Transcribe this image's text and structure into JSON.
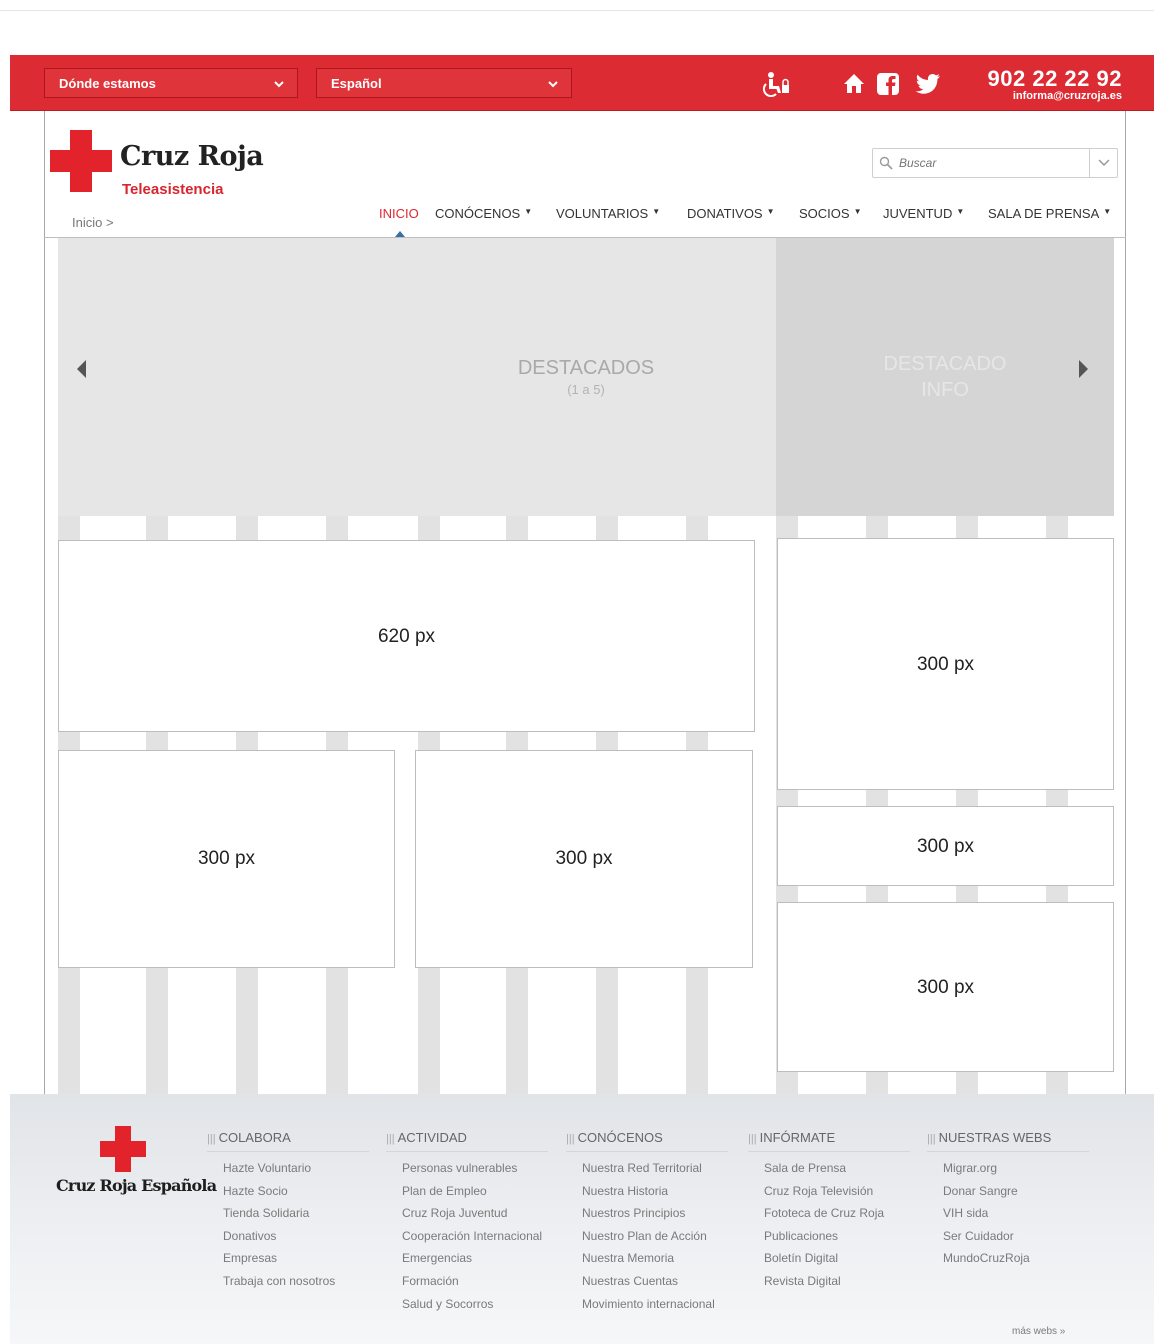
{
  "topbar": {
    "location_select": "Dónde estamos",
    "language_select": "Español",
    "phone": "902 22 22 92",
    "email": "informa@cruzroja.es",
    "icons": [
      "accessibility-icon",
      "home-icon",
      "facebook-icon",
      "twitter-icon"
    ],
    "bar_color": "#dd2b33"
  },
  "header": {
    "brand_title": "Cruz Roja",
    "brand_subtitle": "Teleasistencia",
    "breadcrumb": "Inicio >",
    "search_placeholder": "Buscar",
    "accent_color": "#e1272f"
  },
  "nav": [
    {
      "label": "INICIO",
      "active": true,
      "dropdown": false
    },
    {
      "label": "CONÓCENOS",
      "active": false,
      "dropdown": true
    },
    {
      "label": "VOLUNTARIOS",
      "active": false,
      "dropdown": true
    },
    {
      "label": "DONATIVOS",
      "active": false,
      "dropdown": true
    },
    {
      "label": "SOCIOS",
      "active": false,
      "dropdown": true
    },
    {
      "label": "JUVENTUD",
      "active": false,
      "dropdown": true
    },
    {
      "label": "SALA DE PRENSA",
      "active": false,
      "dropdown": true
    }
  ],
  "carousel": {
    "title": "DESTACADOS",
    "subtitle": "(1 a 5)",
    "info_title": "DESTACADO",
    "info_subtitle": "INFO"
  },
  "boxes": {
    "wide": "620 px",
    "right_top": "300 px",
    "left_bottom": "300 px",
    "middle_bottom": "300 px",
    "right_middle": "300 px",
    "right_bottom": "300 px"
  },
  "footer": {
    "brand": "Cruz Roja Española",
    "more_link": "más webs »",
    "columns": [
      {
        "heading": "COLABORA",
        "items": [
          "Hazte Voluntario",
          "Hazte Socio",
          "Tienda Solidaria",
          "Donativos",
          "Empresas",
          "Trabaja con nosotros"
        ]
      },
      {
        "heading": "ACTIVIDAD",
        "items": [
          "Personas vulnerables",
          "Plan de Empleo",
          "Cruz Roja Juventud",
          "Cooperación Internacional",
          "Emergencias",
          "Formación",
          "Salud y Socorros"
        ]
      },
      {
        "heading": "CONÓCENOS",
        "items": [
          "Nuestra Red Territorial",
          "Nuestra Historia",
          "Nuestros Principios",
          "Nuestro Plan de Acción",
          "Nuestra Memoria",
          "Nuestras Cuentas",
          "Movimiento internacional"
        ]
      },
      {
        "heading": "INFÓRMATE",
        "items": [
          "Sala de Prensa",
          "Cruz Roja Televisión",
          "Fototeca de Cruz Roja",
          "Publicaciones",
          "Boletín Digital",
          "Revista Digital"
        ]
      },
      {
        "heading": "NUESTRAS WEBS",
        "items": [
          "Migrar.org",
          "Donar Sangre",
          "VIH sida",
          "Ser Cuidador",
          "MundoCruzRoja"
        ]
      }
    ]
  }
}
